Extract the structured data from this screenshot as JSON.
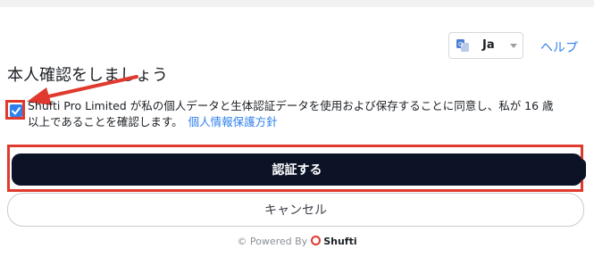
{
  "language": {
    "value": "Ja",
    "icon": "translate-icon"
  },
  "help_label": "ヘルプ",
  "title": "本人確認をしましょう",
  "consent": {
    "checked": true,
    "text": "Shufti Pro Limited が私の個人データと生体認証データを使用および保存することに同意し、私が 16 歳以上であることを確認します。",
    "privacy_link": "個人情報保護方針"
  },
  "buttons": {
    "verify": "認証する",
    "cancel": "キャンセル"
  },
  "footer": {
    "powered_by": "© Powered By",
    "brand": "Shufti"
  },
  "colors": {
    "accent": "#2f80ed",
    "primary_button": "#0c1327",
    "annotation": "#e03a2f"
  }
}
